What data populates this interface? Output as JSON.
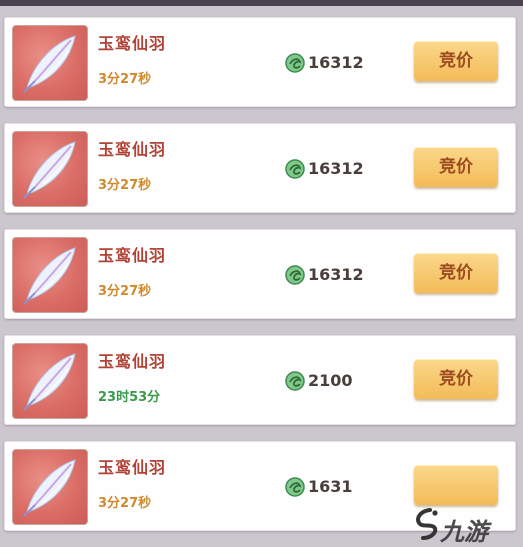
{
  "colors": {
    "timer_short": "#d08a2c",
    "timer_long": "#3a9a4c",
    "item_name": "#b14336",
    "bid_button": "#f3bb58"
  },
  "icons": {
    "item": "feather-icon",
    "currency": "jade-coin-icon",
    "watermark": "jiuyou-logo-icon"
  },
  "listings": [
    {
      "name": "玉鸾仙羽",
      "time_left": "3分27秒",
      "time_state": "short",
      "price": "16312",
      "bid_label": "竞价"
    },
    {
      "name": "玉鸾仙羽",
      "time_left": "3分27秒",
      "time_state": "short",
      "price": "16312",
      "bid_label": "竞价"
    },
    {
      "name": "玉鸾仙羽",
      "time_left": "3分27秒",
      "time_state": "short",
      "price": "16312",
      "bid_label": "竞价"
    },
    {
      "name": "玉鸾仙羽",
      "time_left": "23时53分",
      "time_state": "long",
      "price": "2100",
      "bid_label": "竞价"
    },
    {
      "name": "玉鸾仙羽",
      "time_left": "3分27秒",
      "time_state": "short",
      "price": "1631",
      "bid_label": ""
    }
  ],
  "watermark": {
    "text": "九游"
  }
}
